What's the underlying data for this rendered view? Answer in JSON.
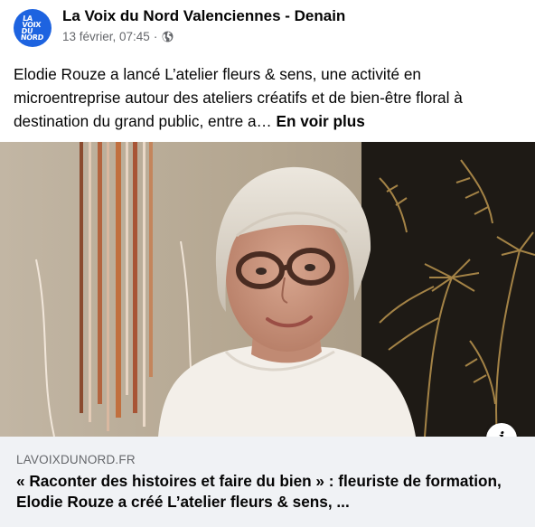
{
  "header": {
    "avatar_logo_lines": [
      "LA",
      "VOIX",
      "DU",
      "NORD"
    ],
    "page_name": "La Voix du Nord Valenciennes - Denain",
    "timestamp": "13 février, 07:45",
    "separator": "·",
    "audience_icon": "globe-icon"
  },
  "post": {
    "text": "Elodie Rouze a lancé L’atelier fleurs & sens, une activité en microentreprise autour des ateliers créatifs et de bien-être floral à destination du grand public, entre a…",
    "see_more_label": "En voir plus"
  },
  "image": {
    "subject": "woman-with-glasses-portrait",
    "info_icon_glyph": "i"
  },
  "link_preview": {
    "domain": "LAVOIXDUNORD.FR",
    "title": "« Raconter des histoires et faire du bien » : fleuriste de formation, Elodie Rouze a créé L’atelier fleurs & sens, ..."
  },
  "colors": {
    "brand_blue": "#1d63e0",
    "secondary_text": "#65676b",
    "link_bg": "#f0f2f5"
  }
}
